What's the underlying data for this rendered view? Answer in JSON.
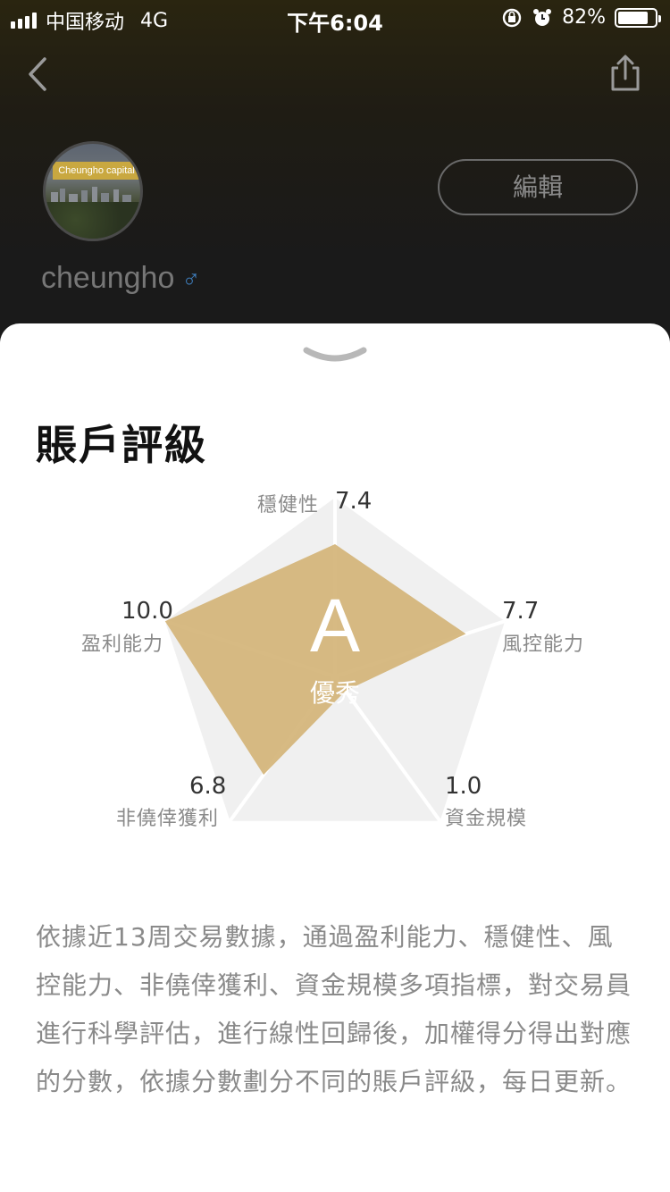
{
  "status_bar": {
    "carrier": "中国移动",
    "network": "4G",
    "time": "下午6:04",
    "battery": "82%",
    "battery_level": 0.82
  },
  "header": {
    "back_icon": "chevron-left-icon",
    "share_icon": "share-icon"
  },
  "profile": {
    "avatar_banner": "Cheungho capital",
    "edit_label": "編輯",
    "username": "cheungho",
    "gender_symbol": "♂"
  },
  "rating": {
    "title": "賬戶評級",
    "grade": "A",
    "grade_label": "優秀",
    "metrics": [
      {
        "label": "穩健性",
        "value": "7.4",
        "score": 7.4
      },
      {
        "label": "風控能力",
        "value": "7.7",
        "score": 7.7
      },
      {
        "label": "資金規模",
        "value": "1.0",
        "score": 1.0
      },
      {
        "label": "非僥倖獲利",
        "value": "6.8",
        "score": 6.8
      },
      {
        "label": "盈利能力",
        "value": "10.0",
        "score": 10.0
      }
    ],
    "description": "依據近13周交易數據，通過盈利能力、穩健性、風控能力、非僥倖獲利、資金規模多項指標，對交易員進行科學評估，進行線性回歸後，加權得分得出對應的分數，依據分數劃分不同的賬戶評級，每日更新。"
  },
  "colors": {
    "accent": "#d4b478",
    "panel": "#f0f0f0"
  }
}
